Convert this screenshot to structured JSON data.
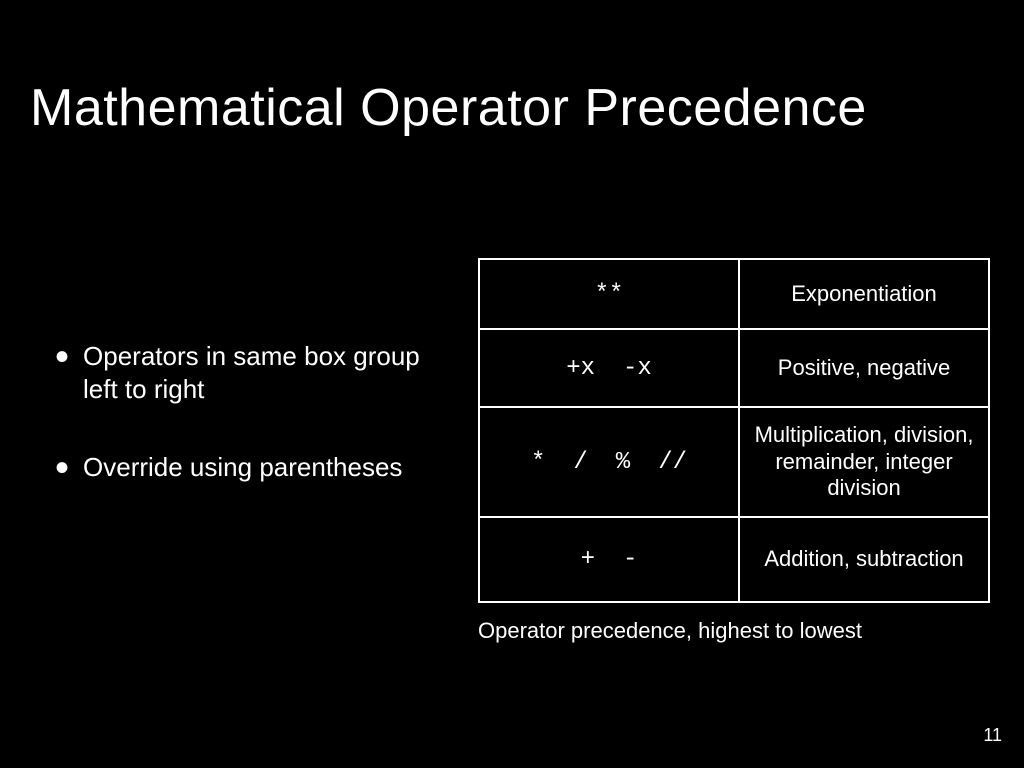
{
  "title": "Mathematical Operator Precedence",
  "bullets": [
    "Operators in same box group left to right",
    "Override using parentheses"
  ],
  "table": {
    "rows": [
      {
        "operators": [
          "**"
        ],
        "description": "Exponentiation"
      },
      {
        "operators": [
          "+x",
          "-x"
        ],
        "description": "Positive, negative"
      },
      {
        "operators": [
          "*",
          "/",
          "%",
          "//"
        ],
        "description": "Multiplication, division, remainder, integer division"
      },
      {
        "operators": [
          "+",
          "-"
        ],
        "description": "Addition, subtraction"
      }
    ],
    "caption": "Operator precedence, highest to lowest"
  },
  "page_number": "11"
}
